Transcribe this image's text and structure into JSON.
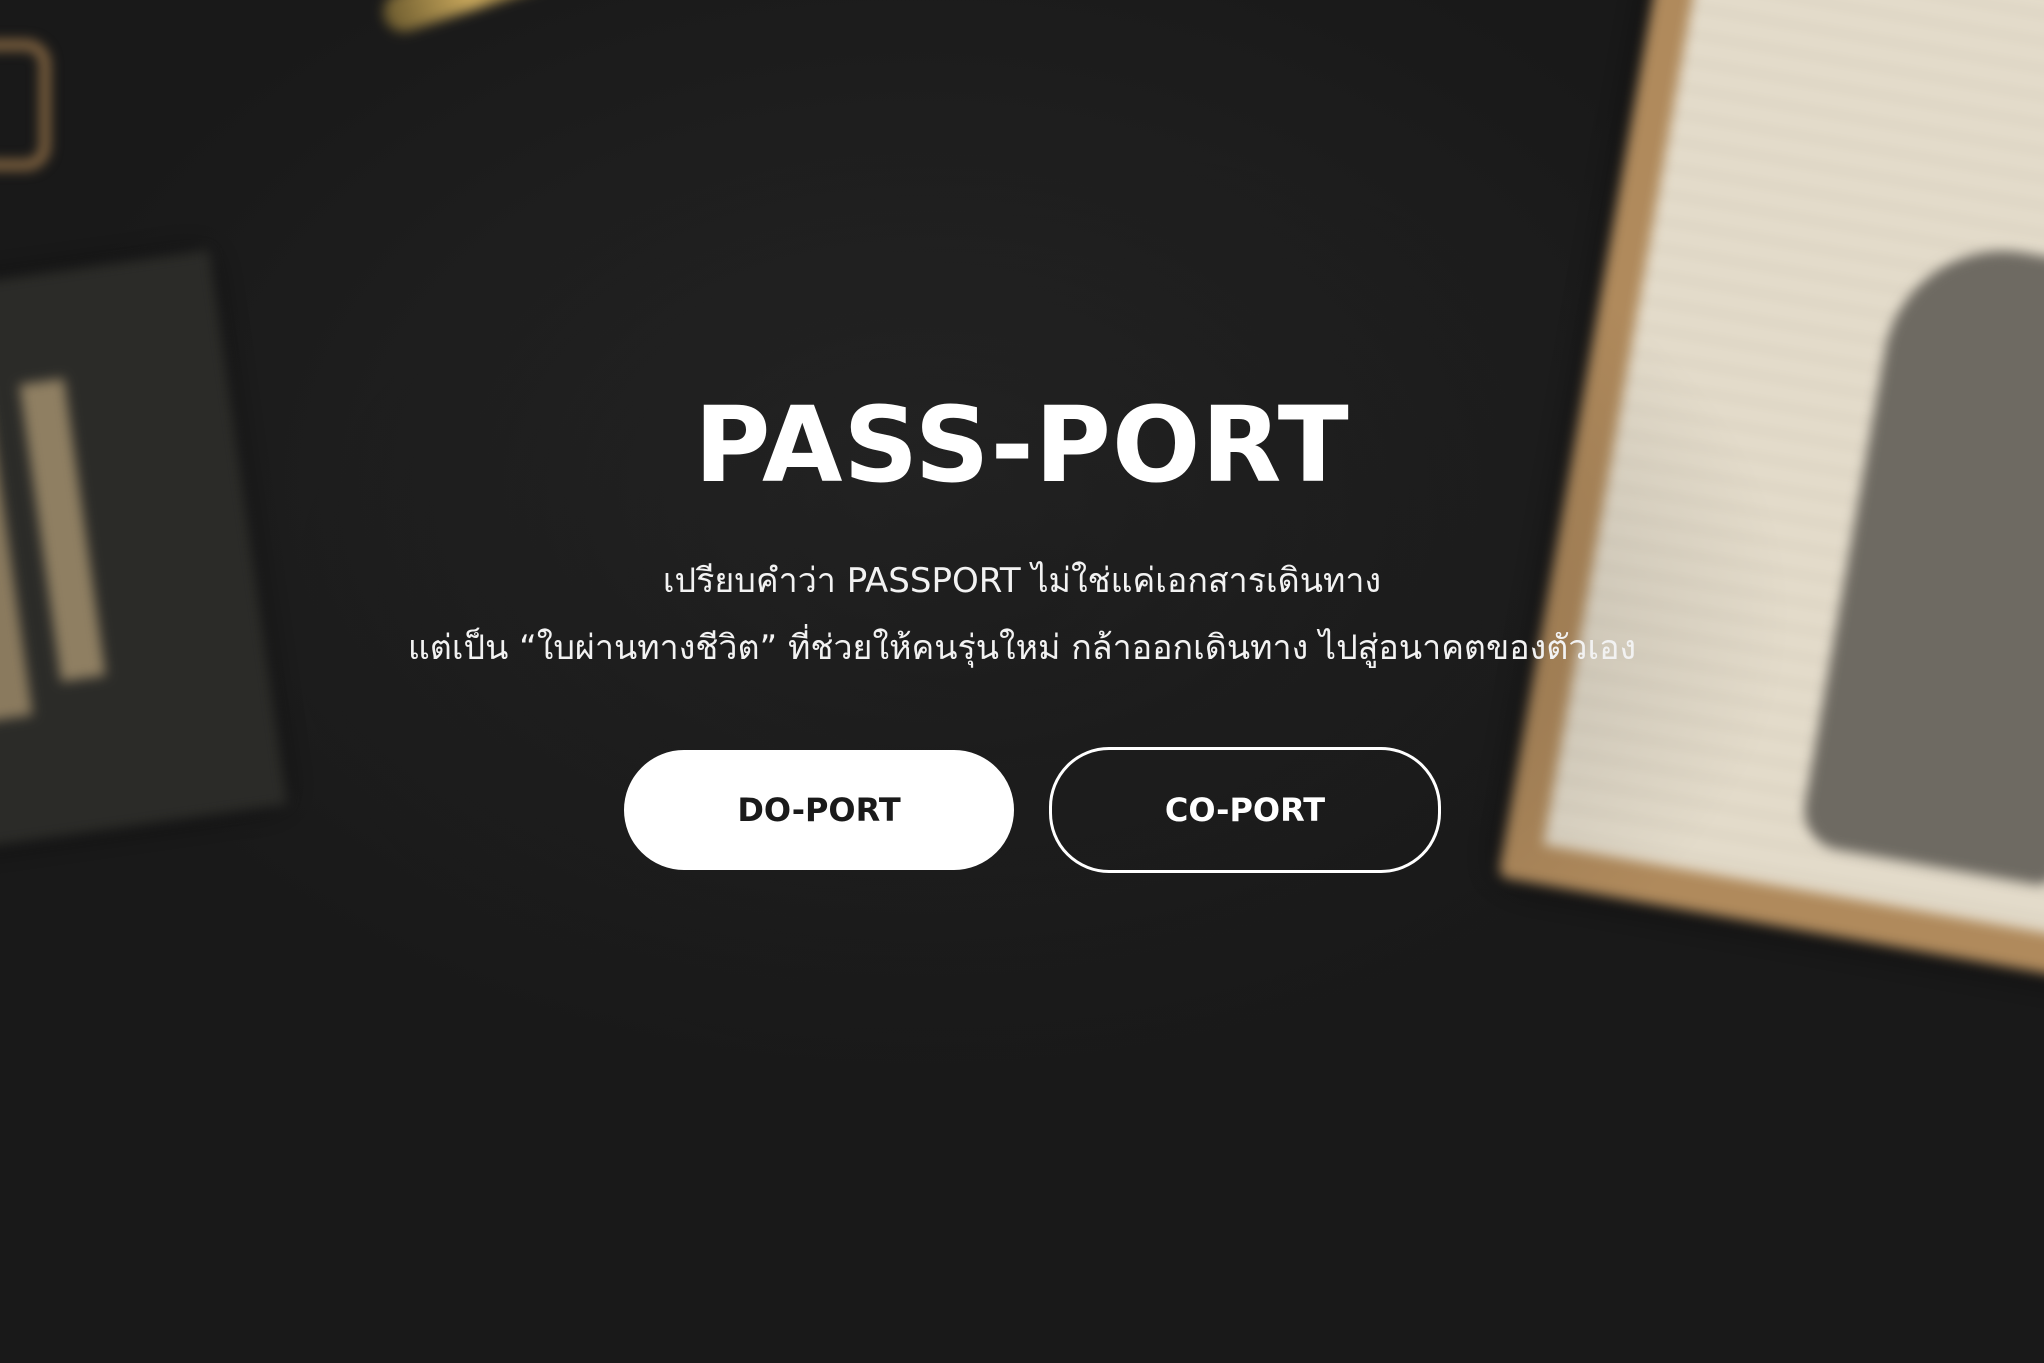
{
  "hero": {
    "title": "PASS-PORT",
    "subtitle_line1": "เปรียบคำว่า PASSPORT ไม่ใช่แค่เอกสารเดินทาง",
    "subtitle_line2": "แต่เป็น “ใบผ่านทางชีวิต” ที่ช่วยให้คนรุ่นใหม่ กล้าออกเดินทาง ไปสู่อนาคตของตัวเอง"
  },
  "buttons": {
    "do_port_label": "DO-PORT",
    "co_port_label": "CO-PORT"
  },
  "colors": {
    "background": "#1c1c1c",
    "text": "#ffffff",
    "primary_button_bg": "#ffffff",
    "primary_button_text": "#1a1a1a"
  }
}
